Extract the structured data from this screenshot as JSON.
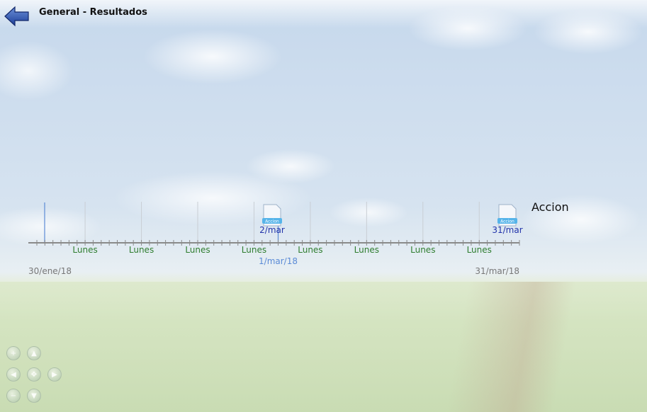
{
  "header": {
    "title": "General - Resultados",
    "back_icon": "back-arrow-icon"
  },
  "timeline": {
    "start_date": "30/ene/18",
    "end_date": "31/mar/18",
    "today_date": "1/mar/18",
    "week_labels": [
      "Lunes",
      "Lunes",
      "Lunes",
      "Lunes",
      "Lunes",
      "Lunes",
      "Lunes",
      "Lunes"
    ],
    "events": [
      {
        "icon_label": "Accion",
        "date": "2/mar"
      },
      {
        "icon_label": "Accion",
        "date": "31/mar"
      }
    ],
    "event_title": "Accion"
  },
  "nav_controls": {
    "icons": [
      "zoom-in-icon",
      "up-arrow-icon",
      "left-arrow-icon",
      "center-icon",
      "right-arrow-icon",
      "zoom-out-icon",
      "down-arrow-icon"
    ]
  },
  "colors": {
    "week_label": "#2f7d2f",
    "today_line": "#5b8bd6",
    "event_date": "#2233aa",
    "axis": "#8a8a8a"
  }
}
